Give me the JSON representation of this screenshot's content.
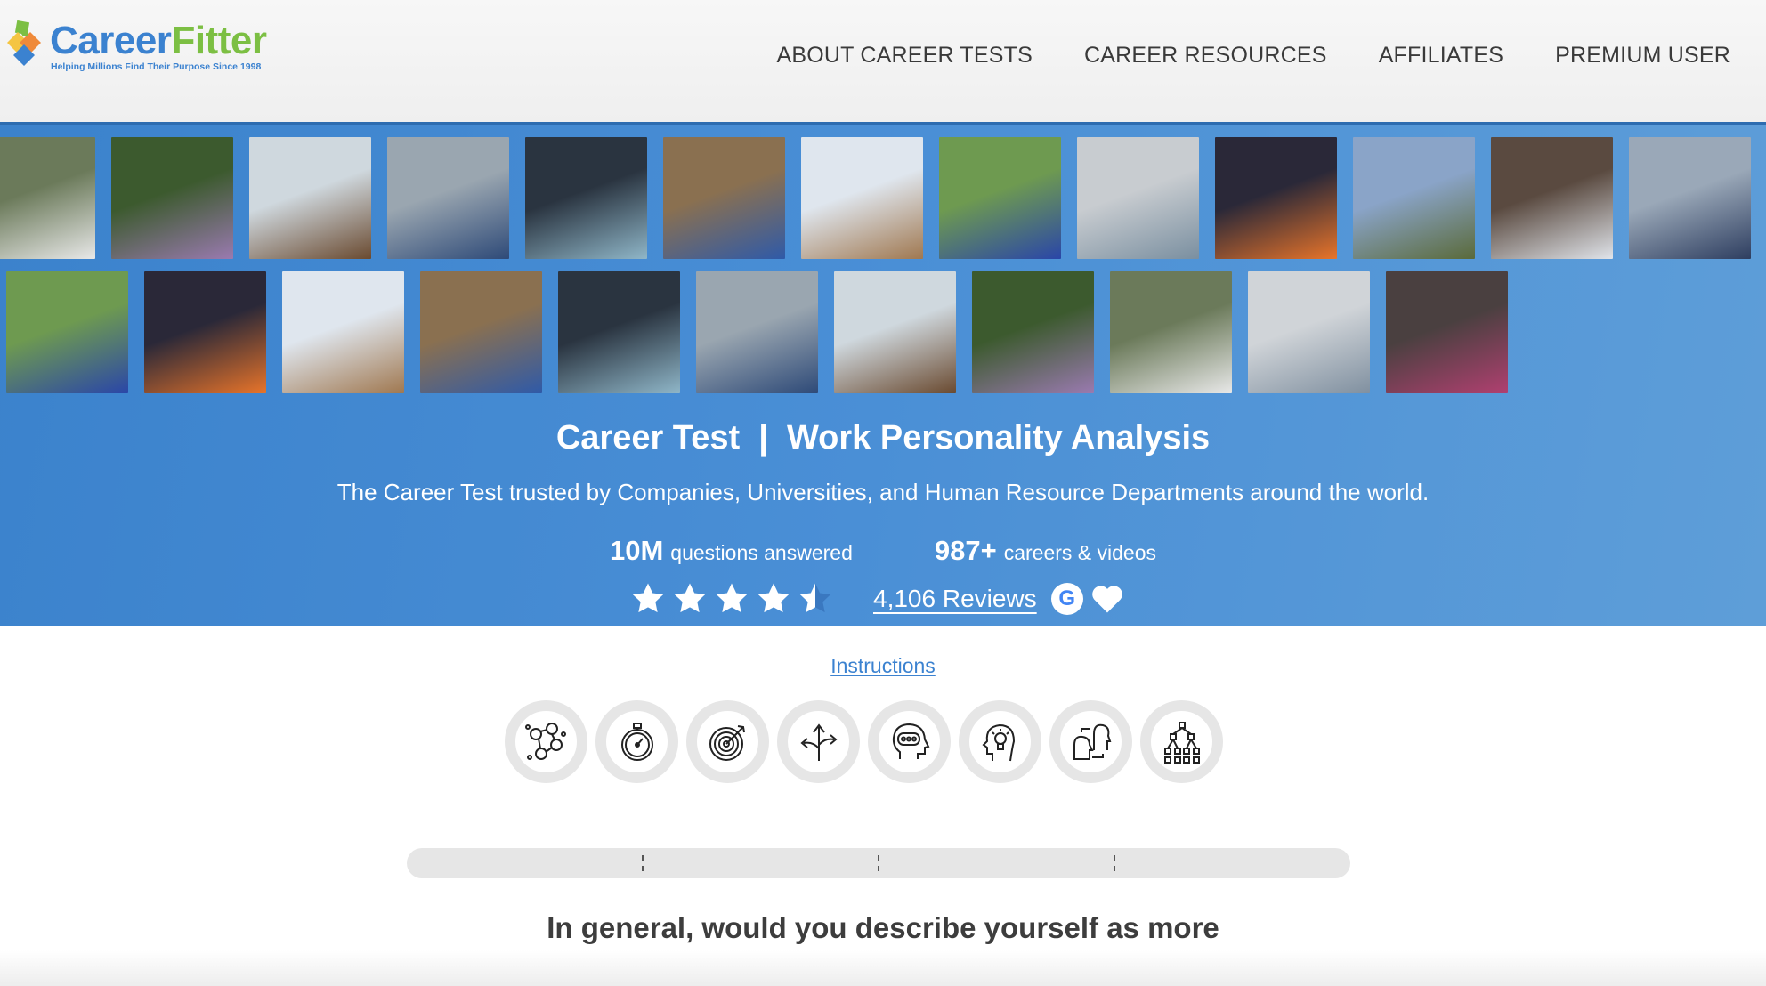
{
  "brand": {
    "name_part1": "Career",
    "name_part2": "Fitter",
    "tagline": "Helping Millions Find Their Purpose Since 1998"
  },
  "nav": {
    "items": [
      {
        "label": "ABOUT CAREER TESTS"
      },
      {
        "label": "CAREER RESOURCES"
      },
      {
        "label": "AFFILIATES"
      },
      {
        "label": "PREMIUM USER"
      }
    ]
  },
  "hero": {
    "title": "Career Test  |  Work Personality Analysis",
    "subtitle": "The Career Test trusted by Companies, Universities, and Human Resource Departments around the world.",
    "stats": [
      {
        "value": "10M",
        "label": "questions answered"
      },
      {
        "value": "987+",
        "label": "careers & videos"
      }
    ],
    "rating": {
      "value": 4.5,
      "max": 5,
      "reviews_label": "4,106 Reviews"
    },
    "photo_rows": [
      [
        "doctor-woman",
        "drone-tablet-field",
        "vet-with-dog",
        "wind-farm-worker",
        "control-room-monitors",
        "construction-engineer",
        "vet-petting-dogs",
        "farmer-field-tablet",
        "pharmacist-shelves",
        "welder-sparks",
        "drone-operator",
        "medical-staff",
        "electrician"
      ],
      [
        "farmer-field-tablet",
        "welder-sparks",
        "vet-petting-dogs",
        "construction-engineer",
        "control-room-monitors",
        "wind-farm-worker",
        "vet-with-dog",
        "drone-tablet-field",
        "doctor-woman",
        "pharmacist-customer",
        "librarian"
      ]
    ]
  },
  "instructions_link": "Instructions",
  "feature_icons": [
    "network-people-icon",
    "stopwatch-icon",
    "target-icon",
    "crossroads-arrows-icon",
    "head-speech-icon",
    "head-lightbulb-icon",
    "faces-exchange-icon",
    "hierarchy-icon"
  ],
  "progress": {
    "value": 0,
    "segments": 4
  },
  "question": "In general, would you describe yourself as more",
  "colors": {
    "brand_blue": "#3b82d0",
    "brand_green": "#7cbf43",
    "hero_blue": "#4a8fd6"
  }
}
